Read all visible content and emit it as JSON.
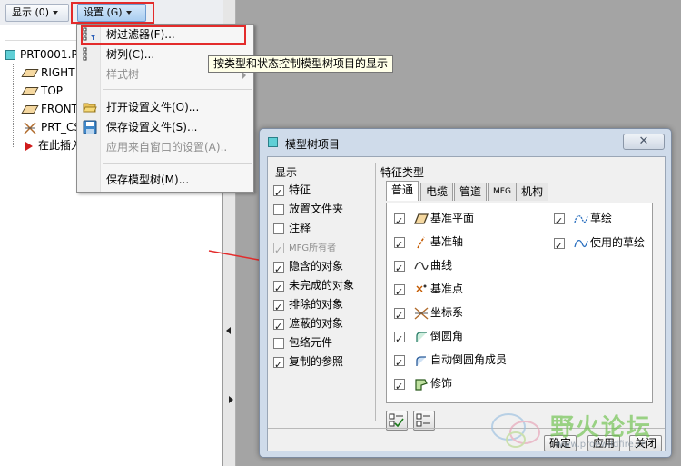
{
  "toolbar": {
    "display_label": "显示 (0)",
    "settings_label": "设置 (G)"
  },
  "tree": {
    "root": "PRT0001.P",
    "items": [
      "RIGHT",
      "TOP",
      "FRONT",
      "PRT_CS",
      "在此插入"
    ]
  },
  "menu": {
    "items": [
      {
        "label": "树过滤器(F)...",
        "enabled": true
      },
      {
        "label": "树列(C)...",
        "enabled": true
      },
      {
        "label": "样式树",
        "enabled": false
      },
      {
        "label": "打开设置文件(O)...",
        "enabled": true
      },
      {
        "label": "保存设置文件(S)...",
        "enabled": true
      },
      {
        "label": "应用来自窗口的设置(A)..",
        "enabled": false
      },
      {
        "label": "保存模型树(M)...",
        "enabled": true
      }
    ]
  },
  "tooltip": "按类型和状态控制模型树项目的显示",
  "dialog": {
    "title": "模型树项目",
    "close_icon": "✕",
    "display": {
      "label": "显示",
      "items": [
        {
          "label": "特征",
          "checked": true,
          "enabled": true
        },
        {
          "label": "放置文件夹",
          "checked": false,
          "enabled": true
        },
        {
          "label": "注释",
          "checked": false,
          "enabled": true
        },
        {
          "label": "MFG所有者",
          "checked": true,
          "enabled": false
        },
        {
          "label": "隐含的对象",
          "checked": true,
          "enabled": true
        },
        {
          "label": "未完成的对象",
          "checked": true,
          "enabled": true
        },
        {
          "label": "排除的对象",
          "checked": true,
          "enabled": true
        },
        {
          "label": "遮蔽的对象",
          "checked": true,
          "enabled": true
        },
        {
          "label": "包络元件",
          "checked": false,
          "enabled": true
        },
        {
          "label": "复制的参照",
          "checked": true,
          "enabled": true
        }
      ]
    },
    "feature_types": {
      "label": "特征类型",
      "tabs": [
        "普通",
        "电缆",
        "管道",
        "MFG",
        "机构"
      ],
      "active_tab": "普通",
      "left_items": [
        {
          "label": "基准平面",
          "icon": "datum-plane-icon",
          "checked": true
        },
        {
          "label": "基准轴",
          "icon": "datum-axis-icon",
          "checked": true
        },
        {
          "label": "曲线",
          "icon": "curve-icon",
          "checked": true
        },
        {
          "label": "基准点",
          "icon": "datum-point-icon",
          "checked": true
        },
        {
          "label": "坐标系",
          "icon": "csys-icon",
          "checked": true
        },
        {
          "label": "倒圆角",
          "icon": "round-icon",
          "checked": true
        },
        {
          "label": "自动倒圆角成员",
          "icon": "auto-round-icon",
          "checked": true
        },
        {
          "label": "修饰",
          "icon": "cosmetic-icon",
          "checked": true
        }
      ],
      "right_items": [
        {
          "label": "草绘",
          "icon": "sketch-icon",
          "checked": true
        },
        {
          "label": "使用的草绘",
          "icon": "used-sketch-icon",
          "checked": true
        }
      ]
    },
    "buttons": {
      "ok": "确定",
      "apply": "应用",
      "close": "关闭"
    }
  },
  "watermark": {
    "text": "野火论坛",
    "url": "www.proewildfire.cn"
  },
  "colors": {
    "highlight_red": "#e32b2b",
    "dialog_frame": "#cfdbea",
    "watermark_green": "#6cc24a"
  }
}
